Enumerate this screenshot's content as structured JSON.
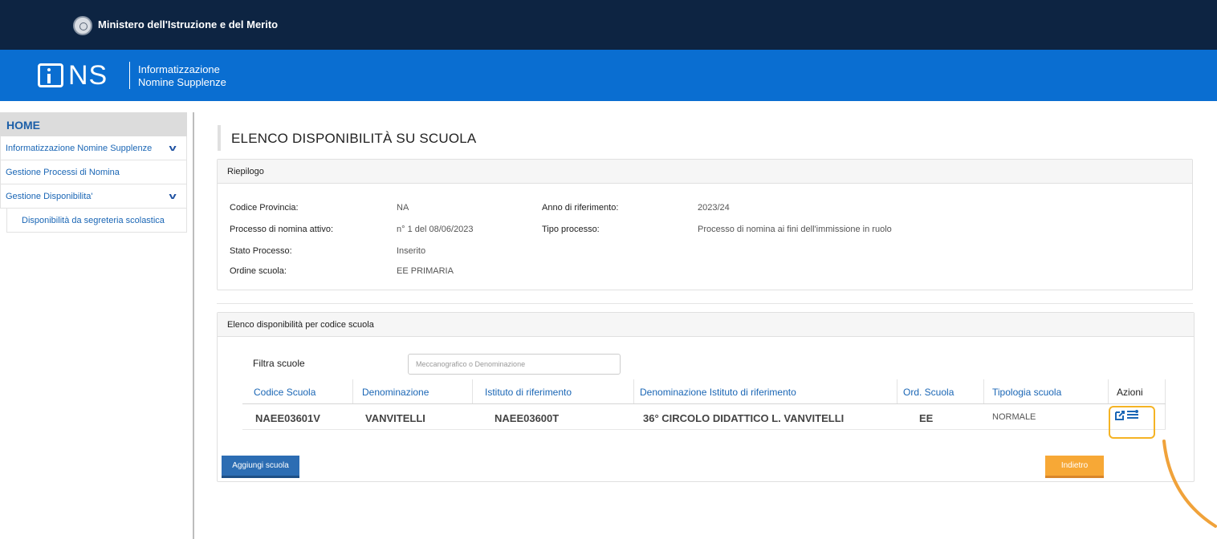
{
  "ministry": {
    "title": "Ministero dell'Istruzione e del Merito"
  },
  "header": {
    "logo_text": "NS",
    "subtitle_line1": "Informatizzazione",
    "subtitle_line2": "Nomine Supplenze"
  },
  "sidebar": {
    "home": "HOME",
    "items": [
      {
        "label": "Informatizzazione Nomine Supplenze",
        "expanded": true
      },
      {
        "label": "Gestione Processi di Nomina"
      },
      {
        "label": "Gestione Disponibilita'",
        "expanded": true
      },
      {
        "label": "Disponibilità da segreteria scolastica"
      }
    ]
  },
  "page": {
    "title": "ELENCO DISPONIBILITÀ SU SCUOLA"
  },
  "riepilogo": {
    "heading": "Riepilogo",
    "fields": [
      {
        "label": "Codice Provincia:",
        "value": "NA"
      },
      {
        "label": "Processo di nomina attivo:",
        "value": "n° 1 del 08/06/2023"
      },
      {
        "label": "Stato Processo:",
        "value": "Inserito"
      },
      {
        "label": "Ordine scuola:",
        "value": "EE PRIMARIA"
      },
      {
        "label": "Anno di riferimento:",
        "value": "2023/24"
      },
      {
        "label": "Tipo processo:",
        "value": "Processo di nomina ai fini dell'immissione in ruolo"
      }
    ]
  },
  "elenco": {
    "heading": "Elenco disponibilità per codice scuola",
    "filter_label": "Filtra scuole",
    "filter_placeholder": "Meccanografico o Denominazione",
    "filter_value": "",
    "columns": [
      "Codice Scuola",
      "Denominazione",
      "Istituto di riferimento",
      "Denominazione Istituto di riferimento",
      "Ord. Scuola",
      "Tipologia scuola",
      "Azioni"
    ],
    "rows": [
      [
        "NAEE03601V",
        "VANVITELLI",
        "NAEE03600T",
        "36° CIRCOLO DIDATTICO L. VANVITELLI",
        "EE",
        "NORMALE"
      ]
    ],
    "action_icons": [
      "edit-icon",
      "list-detail-icon"
    ]
  },
  "buttons": {
    "add_school": "Aggiungi scuola",
    "back": "Indietro"
  },
  "colors": {
    "ministry_bar": "#0d2442",
    "header": "#0a6ed1",
    "link": "#1a66b5",
    "add_button": "#2c6db3",
    "back_button": "#f7a836",
    "highlight": "#f5b324"
  }
}
